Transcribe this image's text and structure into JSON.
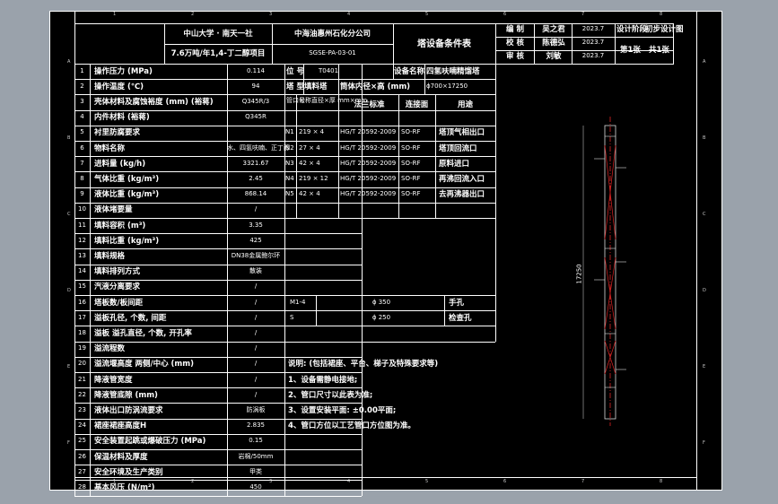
{
  "header": {
    "org": "中山大学 · 南天一社",
    "project": "7.6万吨/年1,4-丁二醇项目",
    "company": "中海油惠州石化分公司",
    "drawing_no": "SGSE-PA-03-01",
    "title": "塔设备条件表"
  },
  "signatures": {
    "rows": [
      {
        "label": "编 制",
        "name": "吴之君",
        "date": "2023.7"
      },
      {
        "label": "校 核",
        "name": "陈德弘",
        "date": "2023.7"
      },
      {
        "label": "审 核",
        "name": "刘敏",
        "date": "2023.7"
      }
    ],
    "stage_label": "设计阶段",
    "stage_value": "初步设计图",
    "sheet": "第1张",
    "sheets": "共1张"
  },
  "process_rows": [
    {
      "n": "1",
      "label": "操作压力 (MPa)",
      "value": "0.114"
    },
    {
      "n": "2",
      "label": "操作温度 (℃)",
      "value": "94"
    },
    {
      "n": "3",
      "label": "壳体材料及腐蚀裕度 (mm) (裕蒋)",
      "value": "Q345R/3"
    },
    {
      "n": "4",
      "label": "内件材料 (裕蒋)",
      "value": "Q345R"
    },
    {
      "n": "5",
      "label": "衬里防腐要求",
      "value": ""
    },
    {
      "n": "6",
      "label": "物料名称",
      "value": "水、四氢呋喃、正丁醇"
    },
    {
      "n": "7",
      "label": "进料量 (kg/h)",
      "value": "3321.67"
    },
    {
      "n": "8",
      "label": "气体比重 (kg/m³)",
      "value": "2.45"
    },
    {
      "n": "9",
      "label": "液体比重 (kg/m³)",
      "value": "868.14"
    },
    {
      "n": "10",
      "label": "液体堵要量",
      "value": "/"
    },
    {
      "n": "11",
      "label": "填料容积 (m³)",
      "value": "3.35"
    },
    {
      "n": "12",
      "label": "填料比重 (kg/m³)",
      "value": "425"
    },
    {
      "n": "13",
      "label": "填料规格",
      "value": "DN38金属鲍尔环"
    },
    {
      "n": "14",
      "label": "填料排列方式",
      "value": "散装"
    },
    {
      "n": "15",
      "label": "汽液分离要求",
      "value": "/"
    },
    {
      "n": "16",
      "label": "塔板数/板间距",
      "value": "/"
    },
    {
      "n": "17",
      "label": "溢板孔径, 个数, 间距",
      "value": "/"
    },
    {
      "n": "18",
      "label": "溢板 溢孔直径, 个数, 开孔率",
      "value": "/"
    },
    {
      "n": "19",
      "label": "溢流程数",
      "value": "/"
    },
    {
      "n": "20",
      "label": "溢流堰高度 两侧/中心 (mm)",
      "value": "/"
    },
    {
      "n": "21",
      "label": "降液管宽度",
      "value": "/"
    },
    {
      "n": "22",
      "label": "降液管底隙 (mm)",
      "value": "/"
    },
    {
      "n": "23",
      "label": "液体出口防涡流要求",
      "value": "防涡板"
    },
    {
      "n": "24",
      "label": "裙座裙座高度H",
      "value": "2.835"
    },
    {
      "n": "25",
      "label": "安全装置起跳或爆破压力 (MPa)",
      "value": "0.15"
    },
    {
      "n": "26",
      "label": "保温材料及厚度",
      "value": "岩棉/50mm"
    },
    {
      "n": "27",
      "label": "安全环境及生产类别",
      "value": "甲类"
    },
    {
      "n": "28",
      "label": "基本风压 (N/m²)",
      "value": "450"
    }
  ],
  "equipment": {
    "position_label": "位 号",
    "position_value": "T0401",
    "name_label": "设备名称",
    "name_value": "四氢呋喃精馏塔",
    "type_label": "塔 型",
    "type_value": "填料塔",
    "dia_label": "筒体内径×高 (mm)",
    "dia_value": "ϕ700×17250"
  },
  "nozzle_header": {
    "num": "管口号",
    "size": "公称直径×厚 mm×mm",
    "std": "法兰标准",
    "face": "连接面",
    "use": "用途"
  },
  "nozzles": [
    {
      "id": "N1",
      "size": "219 × 4",
      "std": "HG/T 20592-2009",
      "face": "SO-RF",
      "use": "塔顶气相出口"
    },
    {
      "id": "N2",
      "size": "27 × 4",
      "std": "HG/T 20592-2009",
      "face": "SO-RF",
      "use": "塔顶回流口"
    },
    {
      "id": "N3",
      "size": "42 × 4",
      "std": "HG/T 20592-2009",
      "face": "SO-RF",
      "use": "原料进口"
    },
    {
      "id": "N4",
      "size": "219 × 12",
      "std": "HG/T 20592-2009",
      "face": "SO-RF",
      "use": "再沸回流入口"
    },
    {
      "id": "N5",
      "size": "42 × 4",
      "std": "HG/T 20592-2009",
      "face": "SO-RF",
      "use": "去再沸器出口"
    }
  ],
  "manholes": [
    {
      "id": "M1-4",
      "size": "ϕ 350",
      "use": "手孔"
    },
    {
      "id": "S",
      "size": "ϕ 250",
      "use": "检查孔"
    }
  ],
  "notes": [
    "说明: (包括裙座、平台、梯子及特殊要求等)",
    "1、设备需静电接地;",
    "2、管口尺寸以此表为准;",
    "3、设置安装平面: ±0.00平面;",
    "4、管口方位以工艺管口方位图为准。"
  ],
  "drawing": {
    "height_label": "17250"
  },
  "border": {
    "cols": [
      "1",
      "2",
      "3",
      "4",
      "5",
      "6",
      "7",
      "8"
    ],
    "rows": [
      "A",
      "B",
      "C",
      "D",
      "E",
      "F"
    ]
  }
}
